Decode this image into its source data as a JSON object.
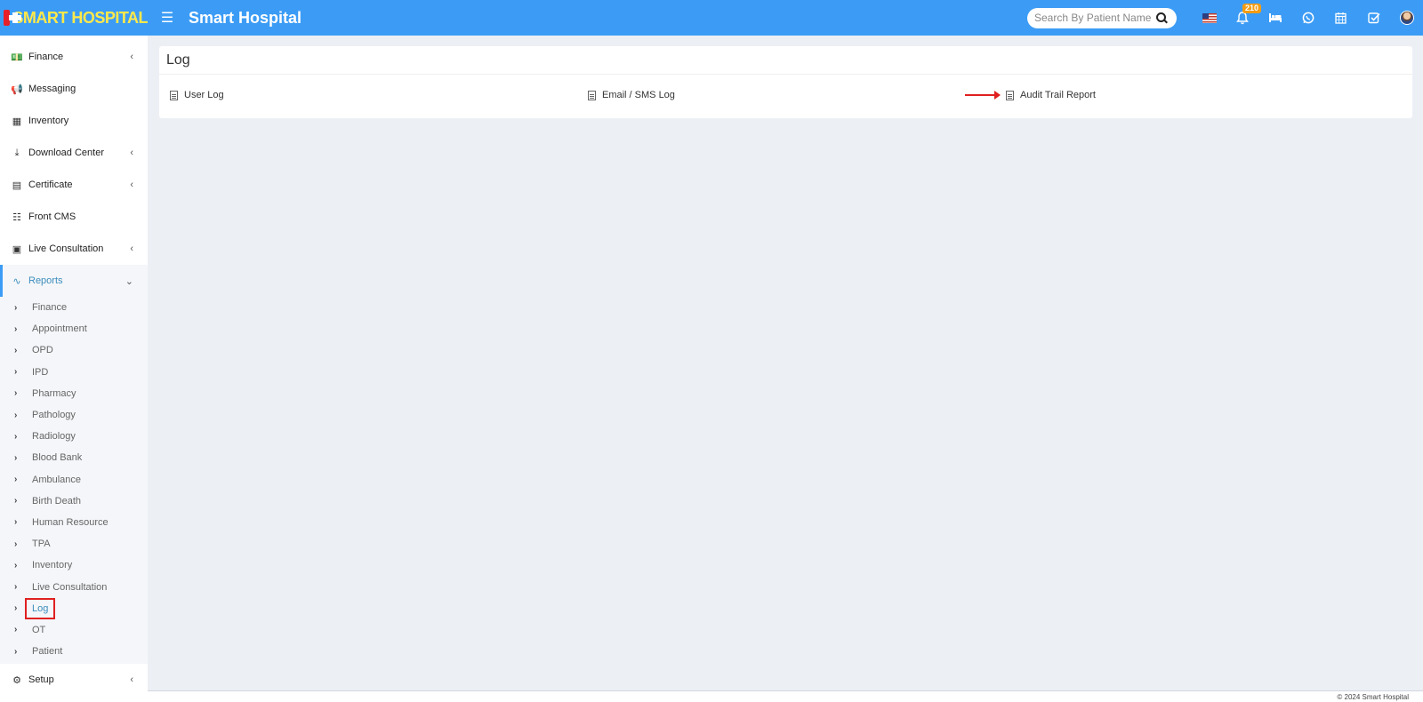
{
  "header": {
    "logo_text": "SMART HOSPITAL",
    "app_title": "Smart Hospital",
    "search_placeholder": "Search By Patient Name",
    "notification_count": "210",
    "icons": [
      "flag-us-icon",
      "bell-icon",
      "bed-icon",
      "whatsapp-icon",
      "calendar-icon",
      "task-check-icon",
      "avatar"
    ]
  },
  "sidebar": {
    "items": [
      {
        "label": "Finance",
        "icon": "money-icon",
        "expandable": true
      },
      {
        "label": "Messaging",
        "icon": "megaphone-icon",
        "expandable": false
      },
      {
        "label": "Inventory",
        "icon": "inventory-icon",
        "expandable": false
      },
      {
        "label": "Download Center",
        "icon": "download-icon",
        "expandable": true
      },
      {
        "label": "Certificate",
        "icon": "certificate-icon",
        "expandable": true
      },
      {
        "label": "Front CMS",
        "icon": "cms-icon",
        "expandable": false
      },
      {
        "label": "Live Consultation",
        "icon": "video-icon",
        "expandable": true
      }
    ],
    "reports": {
      "label": "Reports",
      "icon": "chart-icon",
      "sub_items": [
        "Finance",
        "Appointment",
        "OPD",
        "IPD",
        "Pharmacy",
        "Pathology",
        "Radiology",
        "Blood Bank",
        "Ambulance",
        "Birth Death",
        "Human Resource",
        "TPA",
        "Inventory",
        "Live Consultation",
        "Log",
        "OT",
        "Patient"
      ],
      "current": "Log"
    },
    "setup": {
      "label": "Setup",
      "icon": "gears-icon"
    }
  },
  "main": {
    "title": "Log",
    "links": [
      "User Log",
      "Email / SMS Log",
      "Audit Trail Report"
    ]
  },
  "footer": {
    "text": "© 2024 Smart Hospital"
  },
  "colors": {
    "header_bg": "#3c9cf5",
    "logo_text": "#ffe94a",
    "active_link": "#3c8dbc",
    "highlight": "#e02020",
    "badge": "#f39c12"
  }
}
